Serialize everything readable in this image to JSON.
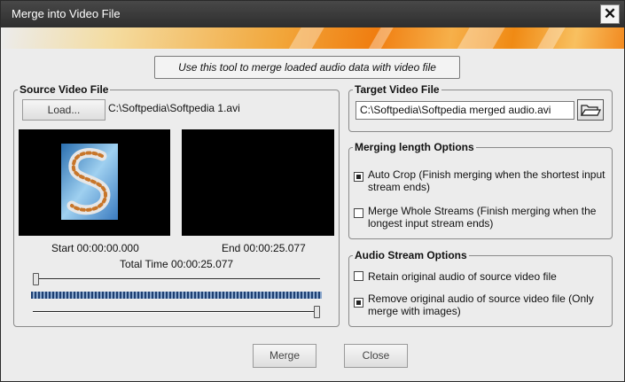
{
  "window": {
    "title": "Merge into Video File",
    "close_glyph": "✕"
  },
  "hint": "Use this tool to merge loaded audio data with video file",
  "source": {
    "group_title": "Source Video File",
    "load_label": "Load...",
    "path": "C:\\Softpedia\\Softpedia 1.avi",
    "start": "Start 00:00:00.000",
    "end": "End 00:00:25.077",
    "total": "Total Time 00:00:25.077",
    "start_position": 0.0,
    "end_position": 1.0
  },
  "target": {
    "group_title": "Target Video File",
    "path": "C:\\Softpedia\\Softpedia merged audio.avi"
  },
  "merging": {
    "group_title": "Merging length Options",
    "options": [
      {
        "label": "Auto Crop (Finish merging when the shortest input stream ends)",
        "checked": true
      },
      {
        "label": "Merge Whole Streams (Finish merging when the longest input stream ends)",
        "checked": false
      }
    ]
  },
  "audio": {
    "group_title": "Audio Stream Options",
    "options": [
      {
        "label": "Retain original audio of source video file",
        "checked": false
      },
      {
        "label": "Remove original audio of source video file (Only merge with images)",
        "checked": true
      }
    ]
  },
  "buttons": {
    "merge": "Merge",
    "close": "Close"
  },
  "icons": {
    "close": "close-icon",
    "folder": "folder-open-icon",
    "preview_logo": "softpedia-s-logo"
  },
  "colors": {
    "titlebar": "#3a3a3a",
    "banner_accent": "#f07d10",
    "waveform": "#1d3f72"
  }
}
